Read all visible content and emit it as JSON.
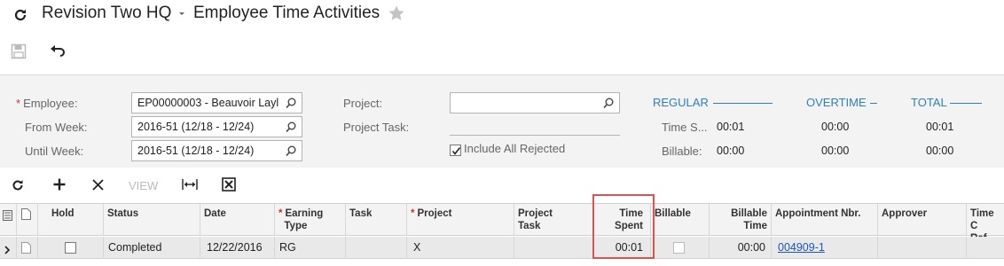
{
  "header": {
    "company": "Revision Two HQ",
    "title": "Employee Time Activities"
  },
  "form": {
    "employee_label": "Employee:",
    "employee_value": "EP00000003 - Beauvoir Layl",
    "from_week_label": "From Week:",
    "from_week_value": "2016-51 (12/18 - 12/24)",
    "until_week_label": "Until Week:",
    "until_week_value": "2016-51 (12/18 - 12/24)",
    "project_label": "Project:",
    "project_value": "",
    "project_task_label": "Project Task:",
    "include_rejected_label": "Include All Rejected",
    "include_rejected_checked": true
  },
  "summary": {
    "regular_label": "REGULAR",
    "overtime_label": "OVERTIME",
    "total_label": "TOTAL",
    "time_spent_label": "Time S...",
    "billable_label": "Billable:",
    "regular_time_spent": "00:01",
    "regular_billable": "00:00",
    "overtime_time_spent": "00:00",
    "overtime_billable": "00:00",
    "total_time_spent": "00:01",
    "total_billable": "00:00"
  },
  "toolbar": {
    "view_label": "VIEW"
  },
  "grid": {
    "columns": {
      "hold": "Hold",
      "status": "Status",
      "date": "Date",
      "earning_type_1": "Earning",
      "earning_type_2": "Type",
      "task": "Task",
      "project": "Project",
      "project_task_1": "Project",
      "project_task_2": "Task",
      "time_spent_1": "Time",
      "time_spent_2": "Spent",
      "billable": "Billable",
      "billable_time_1": "Billable",
      "billable_time_2": "Time",
      "appointment_nbr": "Appointment Nbr.",
      "approver": "Approver",
      "time_card_ref_1": "Time C",
      "time_card_ref_2": "Ref."
    },
    "rows": [
      {
        "hold": false,
        "status": "Completed",
        "date": "12/22/2016",
        "earning_type": "RG",
        "task": "",
        "project": "X",
        "project_task": "",
        "time_spent": "00:01",
        "billable": false,
        "billable_time": "00:00",
        "appointment_nbr": "004909-1",
        "approver": "",
        "time_card_ref": ""
      }
    ]
  },
  "colors": {
    "accent_blue": "#2d7fc1",
    "link_blue": "#1a55c0",
    "highlight_red": "#d9534f",
    "required_red": "#cc3333"
  },
  "icons": [
    "refresh-icon",
    "caret-down-icon",
    "star-icon",
    "save-icon",
    "undo-icon",
    "search-icon",
    "add-icon",
    "delete-icon",
    "fit-columns-icon",
    "export-excel-icon",
    "row-selector-icon",
    "files-icon"
  ]
}
